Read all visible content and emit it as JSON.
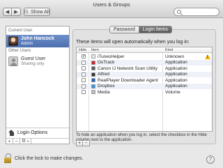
{
  "window": {
    "title": "Users & Groups"
  },
  "toolbar": {
    "back": "◀",
    "forward": "▶",
    "show_all": "Show All",
    "search_placeholder": ""
  },
  "sidebar": {
    "current_user_heading": "Current User",
    "current_user": {
      "name": "John Hancock",
      "role": "Admin"
    },
    "other_users_heading": "Other Users",
    "guest": {
      "name": "Guest User",
      "role": "Sharing only"
    },
    "login_options": "Login Options",
    "add": "+",
    "remove": "−"
  },
  "tabs": [
    {
      "label": "Password"
    },
    {
      "label": "Login Items"
    }
  ],
  "content": {
    "intro": "These items will open automatically when you log in:",
    "columns": {
      "hide": "Hide",
      "item": "Item",
      "kind": "Kind"
    },
    "items": [
      {
        "name": "iTunesHelper",
        "kind": "Unknown",
        "hidden": true,
        "icon_color": "#e8e8e8",
        "warning": true
      },
      {
        "name": "OsTrack",
        "kind": "Application",
        "hidden": false,
        "icon_color": "#d01f26",
        "warning": false
      },
      {
        "name": "Canon IJ Network Scan Utility",
        "kind": "Application",
        "hidden": false,
        "icon_color": "#5a5a5a",
        "warning": false
      },
      {
        "name": "Alfred",
        "kind": "Application",
        "hidden": false,
        "icon_color": "#2f2f2f",
        "warning": false
      },
      {
        "name": "RealPlayer Downloader Agent",
        "kind": "Application",
        "hidden": false,
        "icon_color": "#1d5fb8",
        "warning": false
      },
      {
        "name": "Dropbox",
        "kind": "Application",
        "hidden": false,
        "icon_color": "#3d8fdc",
        "warning": false
      },
      {
        "name": "Media",
        "kind": "Volume",
        "hidden": false,
        "icon_color": "#bdbdbd",
        "warning": false
      }
    ],
    "note": "To hide an application when you log in, select the checkbox in the Hide column next to the application.",
    "add": "+",
    "remove": "−"
  },
  "footer": {
    "lock_text": "Click the lock to make changes.",
    "help": "?"
  },
  "colors": {
    "selection": "#5a7bbb",
    "warning": "#f2b100"
  }
}
